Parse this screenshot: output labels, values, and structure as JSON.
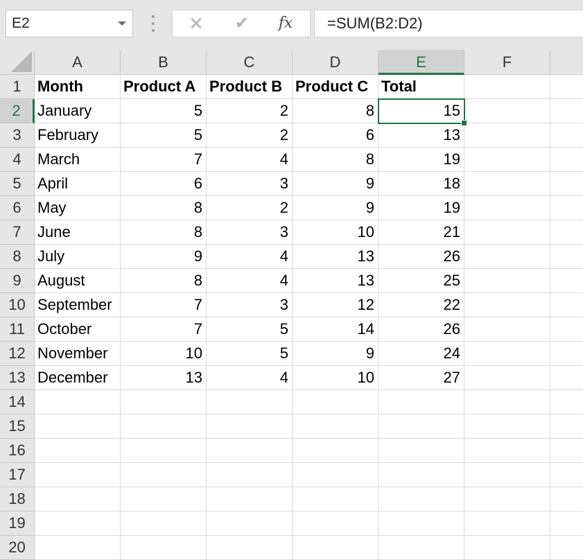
{
  "name_box": "E2",
  "formula_bar": {
    "cancel_icon": "close-icon",
    "enter_icon": "check-icon",
    "fx_label": "fx",
    "formula": "=SUM(B2:D2)"
  },
  "selected_cell": "E2",
  "columns": [
    "A",
    "B",
    "C",
    "D",
    "E",
    "F"
  ],
  "rows": [
    "1",
    "2",
    "3",
    "4",
    "5",
    "6",
    "7",
    "8",
    "9",
    "10",
    "11",
    "12",
    "13",
    "14",
    "15",
    "16",
    "17",
    "18",
    "19",
    "20"
  ],
  "headers": [
    "Month",
    "Product A",
    "Product B",
    "Product C",
    "Total"
  ],
  "data": [
    [
      "January",
      "5",
      "2",
      "8",
      "15"
    ],
    [
      "February",
      "5",
      "2",
      "6",
      "13"
    ],
    [
      "March",
      "7",
      "4",
      "8",
      "19"
    ],
    [
      "April",
      "6",
      "3",
      "9",
      "18"
    ],
    [
      "May",
      "8",
      "2",
      "9",
      "19"
    ],
    [
      "June",
      "8",
      "3",
      "10",
      "21"
    ],
    [
      "July",
      "9",
      "4",
      "13",
      "26"
    ],
    [
      "August",
      "8",
      "4",
      "13",
      "25"
    ],
    [
      "September",
      "7",
      "3",
      "12",
      "22"
    ],
    [
      "October",
      "7",
      "5",
      "14",
      "26"
    ],
    [
      "November",
      "10",
      "5",
      "9",
      "24"
    ],
    [
      "December",
      "13",
      "4",
      "10",
      "27"
    ]
  ],
  "colors": {
    "accent": "#217346",
    "header_bg": "#e6e6e6"
  }
}
